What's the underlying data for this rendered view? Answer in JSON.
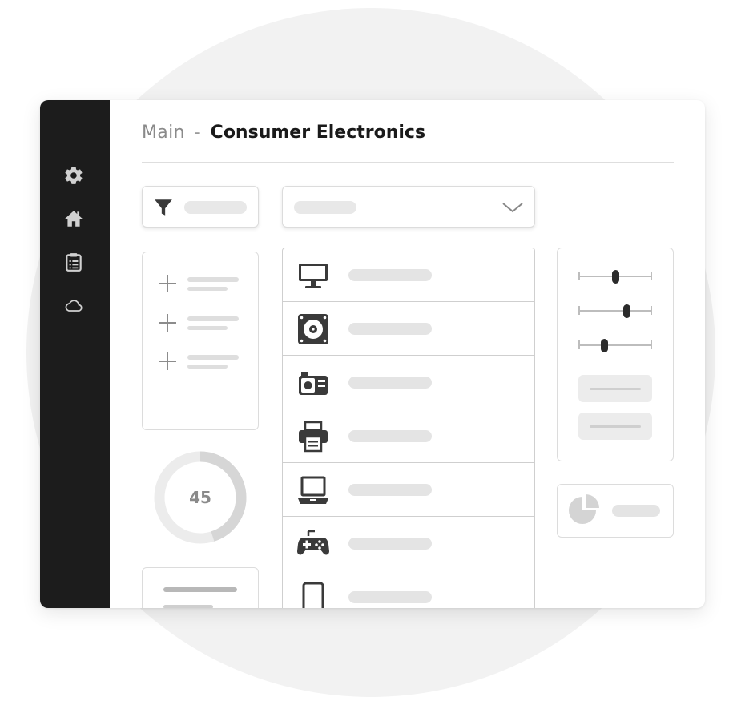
{
  "breadcrumb": {
    "root": "Main",
    "separator": "-",
    "current": "Consumer Electronics"
  },
  "sidebar": {
    "items": [
      {
        "icon": "gear-icon"
      },
      {
        "icon": "home-icon"
      },
      {
        "icon": "clipboard-icon"
      },
      {
        "icon": "cloud-icon"
      }
    ]
  },
  "filter": {
    "icon": "filter-icon"
  },
  "dropdown": {
    "icon": "chevron-down-icon"
  },
  "add_panel": {
    "rows": 3,
    "icon": "plus-icon"
  },
  "progress": {
    "value": "45",
    "fraction": 0.45
  },
  "products": [
    {
      "icon": "monitor-icon"
    },
    {
      "icon": "speaker-icon"
    },
    {
      "icon": "camera-icon"
    },
    {
      "icon": "printer-icon"
    },
    {
      "icon": "laptop-icon"
    },
    {
      "icon": "gamepad-icon"
    },
    {
      "icon": "smartphone-icon"
    }
  ],
  "sliders": [
    {
      "value": 0.5
    },
    {
      "value": 0.65
    },
    {
      "value": 0.35
    }
  ],
  "colors": {
    "sidebar": "#1c1c1c",
    "accent_dark": "#2b2b2b",
    "placeholder": "#e6e6e6"
  }
}
